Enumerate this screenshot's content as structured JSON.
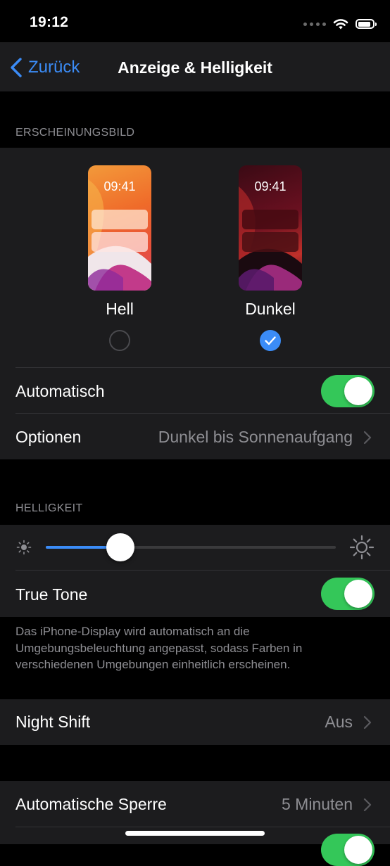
{
  "status_bar": {
    "time": "19:12"
  },
  "nav": {
    "back_label": "Zurück",
    "title": "Anzeige & Helligkeit"
  },
  "appearance": {
    "header": "ERSCHEINUNGSBILD",
    "light": {
      "preview_time": "09:41",
      "label": "Hell",
      "selected": false
    },
    "dark": {
      "preview_time": "09:41",
      "label": "Dunkel",
      "selected": true
    },
    "automatic": {
      "label": "Automatisch",
      "on": true
    },
    "options": {
      "label": "Optionen",
      "value": "Dunkel bis Sonnenaufgang"
    }
  },
  "brightness": {
    "header": "HELLIGKEIT",
    "level": 0.23,
    "true_tone": {
      "label": "True Tone",
      "on": true
    },
    "footer": "Das iPhone-Display wird automatisch an die Umgebungsbeleuchtung angepasst, sodass Farben in verschiedenen Umgebungen einheitlich erscheinen."
  },
  "night_shift": {
    "label": "Night Shift",
    "value": "Aus"
  },
  "auto_lock": {
    "label": "Automatische Sperre",
    "value": "5 Minuten"
  },
  "colors": {
    "accent": "#3b8cf7",
    "toggle_on": "#34c759",
    "cell_bg": "#1c1c1e",
    "secondary_text": "#8e8e93"
  }
}
